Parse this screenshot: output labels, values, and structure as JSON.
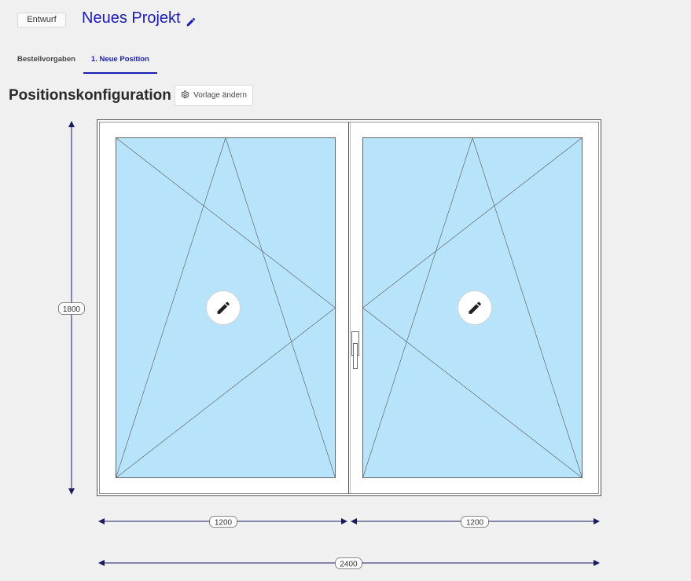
{
  "header": {
    "status_badge": "Entwurf",
    "project_title": "Neues Projekt"
  },
  "tabs": [
    {
      "label": "Bestellvorgaben",
      "active": false
    },
    {
      "label": "1. Neue Position",
      "active": true
    }
  ],
  "section": {
    "title": "Positionskonfiguration",
    "template_button_label": "Vorlage ändern"
  },
  "window": {
    "glass_color": "#b8e4fb",
    "dimensions": {
      "height": "1800",
      "left_sash_width": "1200",
      "right_sash_width": "1200",
      "total_width": "2400"
    }
  },
  "colors": {
    "accent": "#1c1cb4",
    "dimension_line": "#1a1a5e"
  },
  "icons": {
    "title_edit": "pencil-icon",
    "template_button": "gear-icon",
    "sash_edit": "pencil-icon"
  }
}
